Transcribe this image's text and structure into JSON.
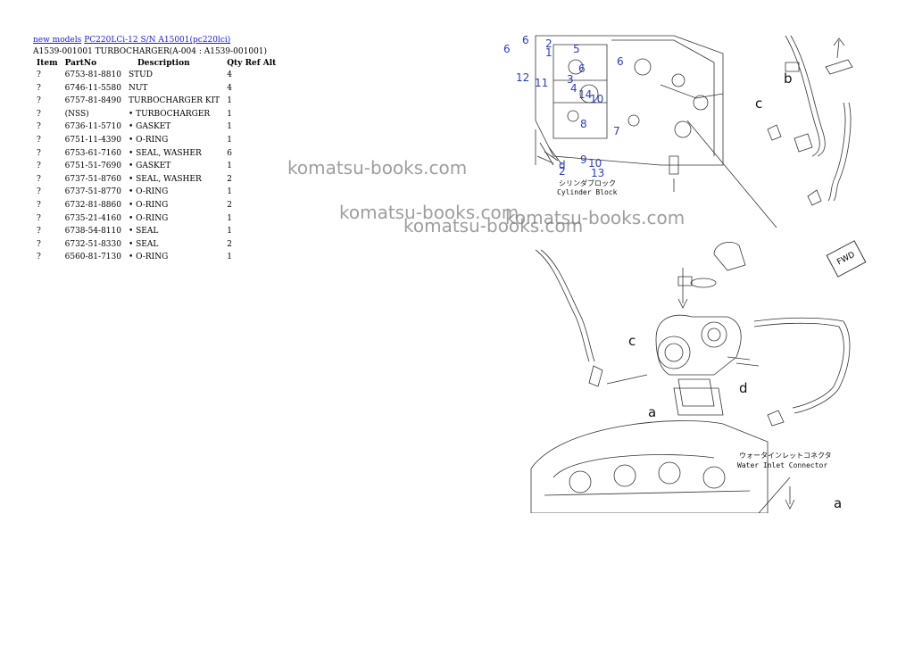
{
  "breadcrumb": {
    "link1": "new models",
    "link2": "PC220LCi-12 S/N A15001(pc220lci)"
  },
  "subtitle": "A1539-001001 TURBOCHARGER(A-004 : A1539-001001)",
  "table": {
    "headers": {
      "item": "Item",
      "part_no": "PartNo",
      "description": "Description",
      "qty": "Qty",
      "ref": "Ref",
      "alt": "Alt"
    },
    "rows": [
      {
        "item": "?",
        "part_no": "6753-81-8810",
        "description": "STUD",
        "qty": "4"
      },
      {
        "item": "?",
        "part_no": "6746-11-5580",
        "description": "NUT",
        "qty": "4"
      },
      {
        "item": "?",
        "part_no": "6757-81-8490",
        "description": "TURBOCHARGER KIT",
        "qty": "1"
      },
      {
        "item": "?",
        "part_no": "(NSS)",
        "description": "• TURBOCHARGER",
        "qty": "1"
      },
      {
        "item": "?",
        "part_no": "6736-11-5710",
        "description": "• GASKET",
        "qty": "1"
      },
      {
        "item": "?",
        "part_no": "6751-11-4390",
        "description": "• O-RING",
        "qty": "1"
      },
      {
        "item": "?",
        "part_no": "6753-61-7160",
        "description": "• SEAL, WASHER",
        "qty": "6"
      },
      {
        "item": "?",
        "part_no": "6751-51-7690",
        "description": "• GASKET",
        "qty": "1"
      },
      {
        "item": "?",
        "part_no": "6737-51-8760",
        "description": "• SEAL, WASHER",
        "qty": "2"
      },
      {
        "item": "?",
        "part_no": "6737-51-8770",
        "description": "• O-RING",
        "qty": "1"
      },
      {
        "item": "?",
        "part_no": "6732-81-8860",
        "description": "• O-RING",
        "qty": "2"
      },
      {
        "item": "?",
        "part_no": "6735-21-4160",
        "description": "• O-RING",
        "qty": "1"
      },
      {
        "item": "?",
        "part_no": "6738-54-8110",
        "description": "• SEAL",
        "qty": "1"
      },
      {
        "item": "?",
        "part_no": "6732-51-8330",
        "description": "• SEAL",
        "qty": "2"
      },
      {
        "item": "?",
        "part_no": "6560-81-7130",
        "description": "• O-RING",
        "qty": "1"
      }
    ]
  },
  "watermarks": [
    "komatsu-books.com",
    "komatsu-books.com",
    "komatsu-books.com",
    "komatsu-books.com"
  ],
  "diagram": {
    "callouts": [
      "6",
      "6",
      "2",
      "1",
      "5",
      "6",
      "6",
      "12",
      "11",
      "3",
      "4",
      "14",
      "10",
      "8",
      "7",
      "9",
      "10",
      "13",
      "d",
      "2"
    ],
    "letters": [
      "b",
      "c",
      "c",
      "d",
      "a",
      "a"
    ],
    "label_jp": "シリンダブロック",
    "label_en": "Cylinder Block",
    "label2_jp": "ウォータインレットコネクタ",
    "label2_en": "Water Inlet Connector",
    "fwd": "FWD"
  },
  "colors": {
    "link": "#1a1aff",
    "callout": "#2b3bd0",
    "watermark": "#787878"
  }
}
